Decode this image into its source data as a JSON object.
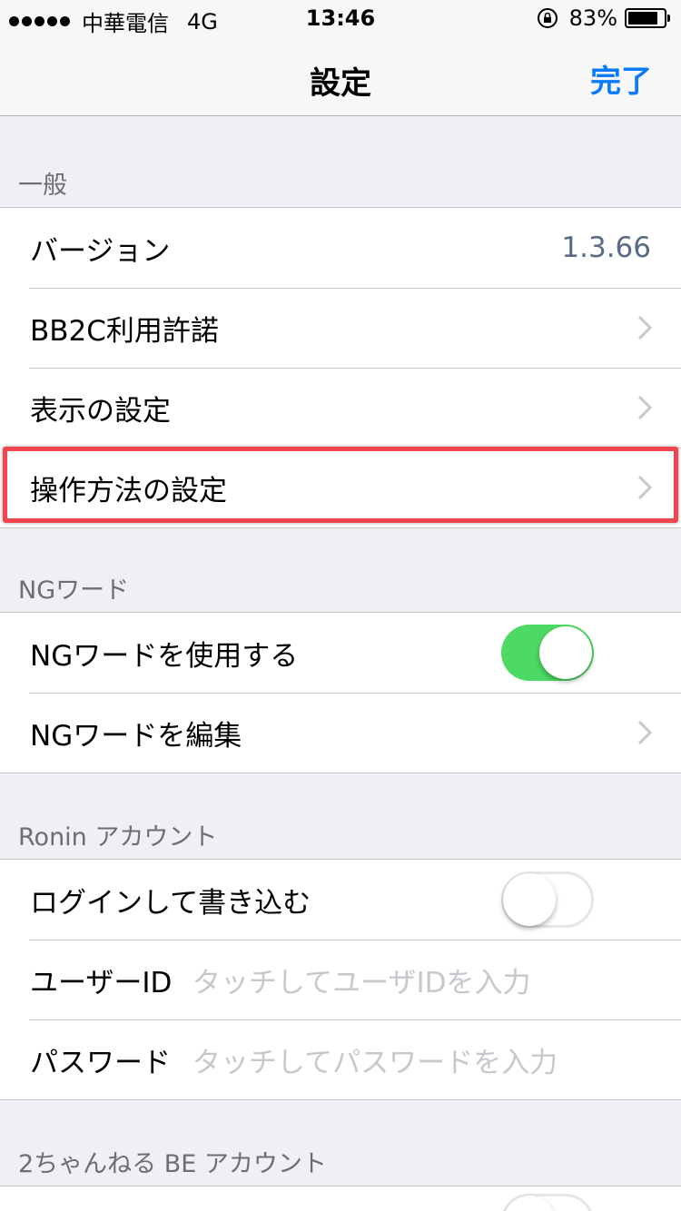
{
  "status_bar": {
    "carrier": "中華電信",
    "network": "4G",
    "time": "13:46",
    "battery_pct": "83%",
    "battery_level": 0.83
  },
  "nav": {
    "title": "設定",
    "done_label": "完了",
    "accent_color": "#0a7aff"
  },
  "sections": {
    "general": {
      "header": "一般",
      "version_label": "バージョン",
      "version_value": "1.3.66",
      "license_label": "BB2C利用許諾",
      "display_label": "表示の設定",
      "operation_label": "操作方法の設定"
    },
    "ng": {
      "header": "NGワード",
      "use_label": "NGワードを使用する",
      "use_enabled": true,
      "edit_label": "NGワードを編集"
    },
    "ronin": {
      "header": "Ronin アカウント",
      "login_label": "ログインして書き込む",
      "login_enabled": false,
      "user_label": "ユーザーID",
      "user_placeholder": "タッチしてユーザIDを入力",
      "password_label": "パスワード",
      "password_placeholder": "タッチしてパスワードを入力"
    },
    "be": {
      "header": "2ちゃんねる BE アカウント"
    }
  },
  "highlight_color": "#f0454e"
}
